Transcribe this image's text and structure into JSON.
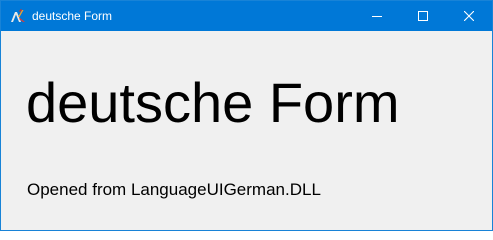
{
  "window": {
    "title": "deutsche Form",
    "icons": {
      "app": "app-logo-icon",
      "minimize": "minimize-icon",
      "maximize": "maximize-icon",
      "close": "close-icon"
    },
    "colors": {
      "titlebar": "#0078d7",
      "client_background": "#f0f0f0",
      "text": "#000000"
    }
  },
  "content": {
    "heading": "deutsche Form",
    "source_label": "Opened from LanguageUIGerman.DLL"
  }
}
